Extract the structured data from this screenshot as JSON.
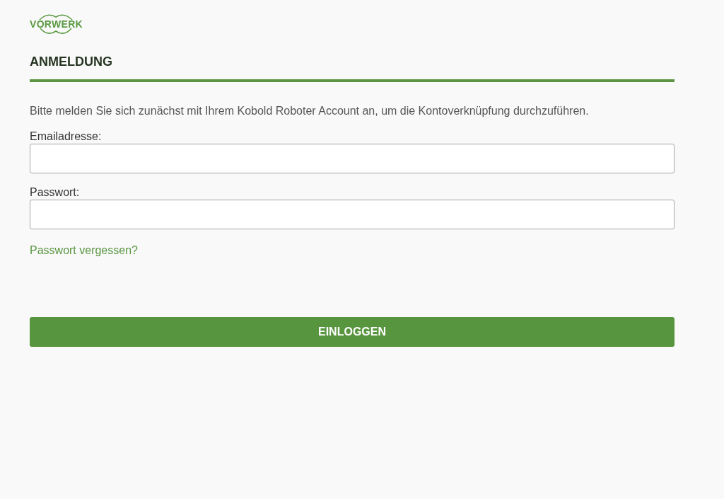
{
  "logo": {
    "text": "VORWERK"
  },
  "heading": "ANMELDUNG",
  "intro": "Bitte melden Sie sich zunächst mit Ihrem Kobold Roboter Account an, um die Kontoverknüpfung durchzuführen.",
  "fields": [
    {
      "label": "Emailadresse:"
    },
    {
      "label": "Passwort:"
    }
  ],
  "forgot_link": "Passwort vergessen?",
  "login_button": "EINLOGGEN"
}
